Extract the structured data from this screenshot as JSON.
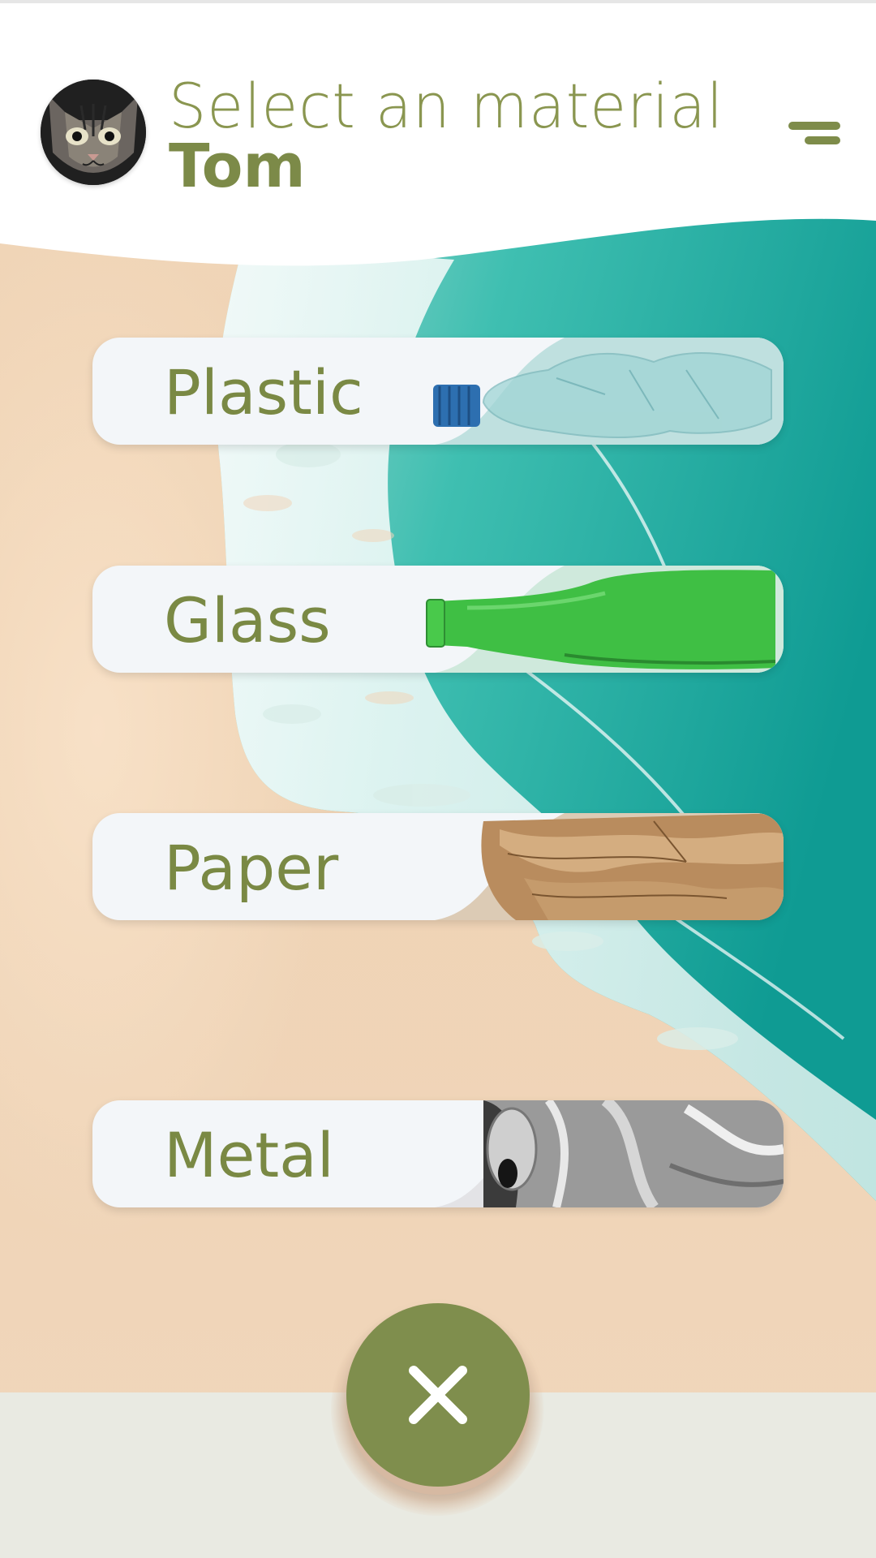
{
  "header": {
    "title": "Select an material",
    "username": "Tom"
  },
  "materials": [
    {
      "label": "Plastic",
      "art": "plastic-bottle-icon"
    },
    {
      "label": "Glass",
      "art": "glass-bottle-icon"
    },
    {
      "label": "Paper",
      "art": "paper-pile-icon"
    },
    {
      "label": "Metal",
      "art": "crushed-can-icon"
    }
  ],
  "icons": {
    "menu": "menu-icon",
    "close": "close-icon",
    "avatar": "cat-avatar"
  },
  "colors": {
    "accent": "#7f8e4d",
    "text_green": "#8a9650",
    "card_bg": "#f3f6f9",
    "sand": "#f0d5b8",
    "sea": "#1fb3a5"
  }
}
